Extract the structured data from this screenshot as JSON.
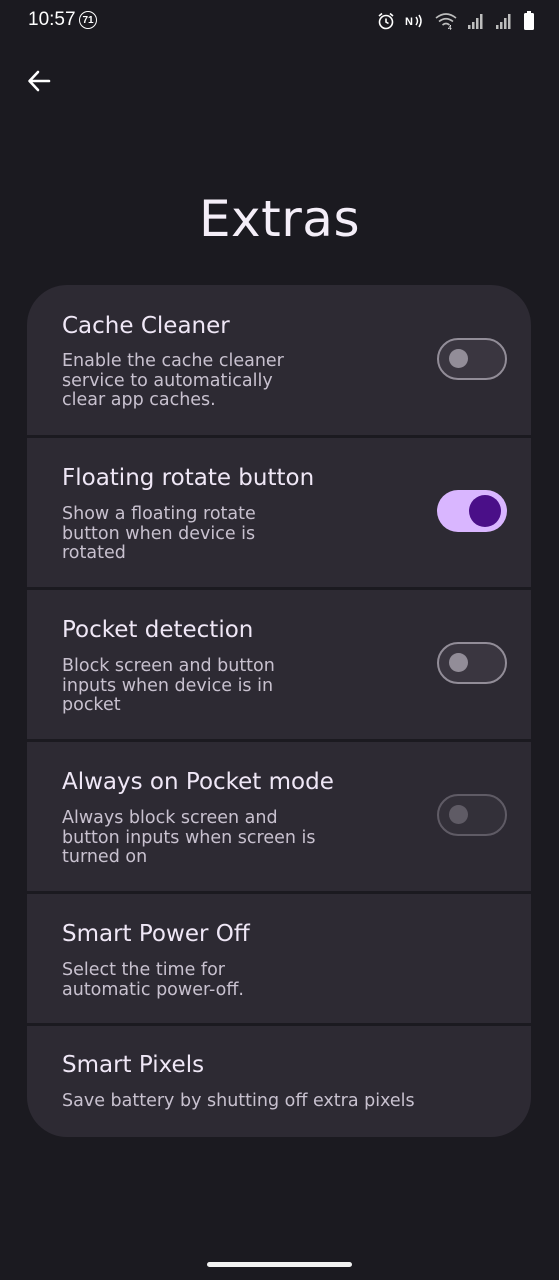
{
  "status_bar": {
    "time": "10:57",
    "notification_count": "71",
    "icons": [
      "alarm-icon",
      "nfc-icon",
      "wifi-icon",
      "signal-icon",
      "signal-icon",
      "battery-icon"
    ]
  },
  "header": {
    "back_icon": "arrow-left-icon",
    "title": "Extras"
  },
  "settings": {
    "items": [
      {
        "title": "Cache Cleaner",
        "desc_lines": [
          "Enable the cache cleaner",
          "service to automatically",
          "clear app caches."
        ],
        "toggle": "off"
      },
      {
        "title": "Floating rotate button",
        "desc_lines": [
          "Show a floating rotate",
          "button when device is",
          "rotated"
        ],
        "toggle": "on"
      },
      {
        "title": "Pocket detection",
        "desc_lines": [
          "Block screen and button",
          "inputs when device is in",
          "pocket"
        ],
        "toggle": "off"
      },
      {
        "title": "Always on Pocket mode",
        "desc_lines": [
          "Always block screen and",
          "button inputs when screen is",
          "turned on"
        ],
        "toggle": "off-disabled"
      },
      {
        "title": "Smart Power Off",
        "desc_lines": [
          "Select the time for",
          "automatic power-off."
        ]
      },
      {
        "title": "Smart Pixels",
        "desc_lines": [
          "Save battery by shutting off extra pixels"
        ]
      }
    ]
  },
  "colors": {
    "background": "#1b1a20",
    "card": "#2d2a33",
    "switch_on_track": "#d9b6ff",
    "switch_on_knob": "#4a0f88",
    "switch_off_outline": "#928d98"
  }
}
